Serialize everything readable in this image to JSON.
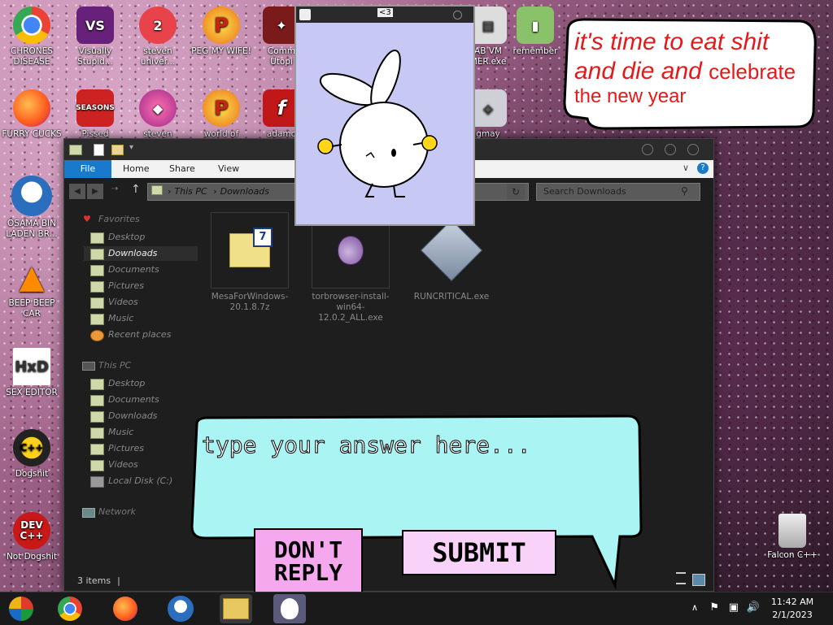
{
  "desktop_icons": [
    {
      "label": "CHRONES\nDISEASE",
      "icon": "chrome-icon"
    },
    {
      "label": "Visually\nStupid...",
      "icon": "visual-studio-icon"
    },
    {
      "label": "steven\nuniver...",
      "icon": "steven-universe-icon"
    },
    {
      "label": "PEG MY WIFE!",
      "icon": "peggle-icon"
    },
    {
      "label": "Comm\nUtopi",
      "icon": "commando-icon"
    },
    {
      "label": "AB VM\nMER.exe",
      "icon": "vm-icon"
    },
    {
      "label": "remember",
      "icon": "remember-icon"
    },
    {
      "label": "FURRY CUCKS",
      "icon": "firefox-icon"
    },
    {
      "label": "Pissed\nBirds...",
      "icon": "angry-birds-icon"
    },
    {
      "label": "steven",
      "icon": "steven-icon"
    },
    {
      "label": "world of",
      "icon": "world-of-peggle-icon"
    },
    {
      "label": "adamo",
      "icon": "flash-icon"
    },
    {
      "label": "gmay",
      "icon": "gmay-icon"
    },
    {
      "label": "OSAMA BIN\nLADEN BR...",
      "icon": "obama-icon"
    },
    {
      "label": "BEEP BEEP\nCAR",
      "icon": "vlc-icon"
    },
    {
      "label": "SEX EDITOR",
      "icon": "hxd-icon"
    },
    {
      "label": "Dogshit",
      "icon": "codeblocks-icon"
    },
    {
      "label": "Not Dogshit",
      "icon": "devcpp-icon"
    },
    {
      "label": "Falcon C++",
      "icon": "recycle-bin-icon"
    }
  ],
  "speech_bubble": {
    "line1": "it's time to eat shit",
    "line2a": "and die and ",
    "line2b": "celebrate",
    "line3": "the new year"
  },
  "popup": {
    "title": "<3"
  },
  "explorer": {
    "tabs": {
      "file": "File",
      "home": "Home",
      "share": "Share",
      "view": "View"
    },
    "breadcrumb": {
      "root": "This PC",
      "sep": "›",
      "current": "Downloads"
    },
    "search_placeholder": "Search Downloads",
    "nav": {
      "favorites": "Favorites",
      "fav_items": [
        "Desktop",
        "Downloads",
        "Documents",
        "Pictures",
        "Videos",
        "Music",
        "Recent places"
      ],
      "this_pc": "This PC",
      "pc_items": [
        "Desktop",
        "Documents",
        "Downloads",
        "Music",
        "Pictures",
        "Videos",
        "Local Disk (C:)"
      ],
      "network": "Network"
    },
    "files": [
      {
        "name": "MesaForWindows-20.1.8.7z",
        "icon": "7zip-archive-icon"
      },
      {
        "name": "torbrowser-install-win64-12.0.2_ALL.exe",
        "icon": "tor-onion-icon"
      },
      {
        "name": "RUNCRITICAL.exe",
        "icon": "runcritical-icon"
      }
    ],
    "status": "3 items"
  },
  "answer_bubble": {
    "placeholder": "type your answer here...",
    "dont_reply": "DON'T REPLY",
    "submit": "SUBMIT"
  },
  "taskbar": {
    "time": "11:42 AM",
    "date": "2/1/2023"
  },
  "colors": {
    "speech_red": "#e41a1a",
    "answer_bg": "#aaf4f4",
    "dont_reply_bg": "#f6a8ee",
    "submit_bg": "#f8d2f8",
    "popup_bg": "#c8c8f4",
    "file_tab": "#1979ca"
  }
}
